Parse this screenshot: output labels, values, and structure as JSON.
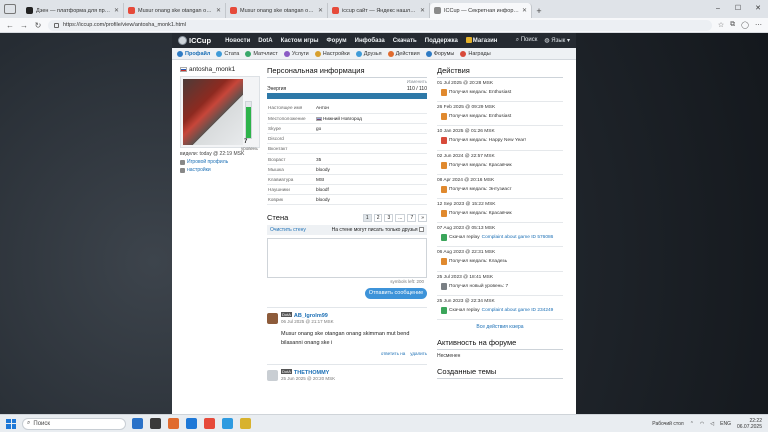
{
  "browser": {
    "tabs": [
      {
        "title": "Дзен — платформа для просмо",
        "color": "#222222",
        "active": false
      },
      {
        "title": "Musur onang ske otangan onang s",
        "color": "#e64a3a",
        "active": false
      },
      {
        "title": "Musur onang ske otangan onang",
        "color": "#e64a3a",
        "active": false
      },
      {
        "title": "iccup сайт — Яндекс нашлось 6",
        "color": "#e64a3a",
        "active": false
      },
      {
        "title": "ICCup — Секретная информаци",
        "color": "#8a8a8a",
        "active": true
      }
    ],
    "url": "https://iccup.com/profile/view/antosha_monk1.html",
    "window_controls": [
      "–",
      "☐",
      "✕"
    ]
  },
  "topnav": {
    "logo": "ICCup",
    "links": [
      "Новости",
      "DotA",
      "Кастом игры",
      "Форум",
      "Инфобаза",
      "Скачать",
      "Поддержка",
      "Магазин"
    ],
    "search": "Поиск",
    "language": "Язык"
  },
  "subnav": [
    {
      "label": "Профайл",
      "color": "#2e7bc4",
      "active": true
    },
    {
      "label": "Стата",
      "color": "#3f9bd8",
      "active": false
    },
    {
      "label": "Матчлист",
      "color": "#38a86a",
      "active": false
    },
    {
      "label": "Услуги",
      "color": "#8a5bc4",
      "active": false
    },
    {
      "label": "Настройки",
      "color": "#d8a02e",
      "active": false
    },
    {
      "label": "Друзья",
      "color": "#3f9bd8",
      "active": false
    },
    {
      "label": "Действия",
      "color": "#e06b2e",
      "active": false
    },
    {
      "label": "Форумы",
      "color": "#2e7bc4",
      "active": false
    },
    {
      "label": "Награды",
      "color": "#d84a3a",
      "active": false
    }
  ],
  "profile": {
    "username": "antosha_monk1",
    "level": "7",
    "level_caption": "уровень",
    "level_fill": 0.85,
    "last_seen": "видели: today @ 22:19 MSK",
    "links": [
      "Игровой профиль",
      "настройки"
    ]
  },
  "personal": {
    "title": "Персональная информация",
    "edit": "Изменить",
    "energy_label": "Энергия",
    "energy_value": "110 / 110",
    "energy_fill": 1.0,
    "rows": [
      {
        "k": "Настоящее имя",
        "v": "Антон"
      },
      {
        "k": "Местоположение",
        "v": "Нижний Новгород"
      },
      {
        "k": "Skype",
        "v": "go"
      },
      {
        "k": "Discord",
        "v": ""
      },
      {
        "k": "Вконтакт",
        "v": ""
      },
      {
        "k": "Возраст",
        "v": "35"
      },
      {
        "k": "Мышка",
        "v": "bloody"
      },
      {
        "k": "Клавиатура",
        "v": "MSI"
      },
      {
        "k": "Наушники",
        "v": "bloodf"
      },
      {
        "k": "Коврик",
        "v": "bloody"
      }
    ]
  },
  "wall": {
    "title": "Стена",
    "pages": [
      "1",
      "2",
      "3",
      "...",
      "7",
      "»"
    ],
    "clear_link": "Очистить стену",
    "friends_only": "На стене могут писать только друзья",
    "counter": "symbols left: 200",
    "send_button": "Отпавить сообщение",
    "posts": [
      {
        "tag": "DotA",
        "author": "AB_Igrolm99",
        "date": "06 Jul 2025 @ 21:17 MSK",
        "text": "Musur onang ske otangan onang skimman mut bend bilasanni onang ske i",
        "actions": [
          "ответить на",
          "удалить"
        ],
        "avatar_color": "#8d5b3a"
      },
      {
        "tag": "DotA",
        "author": "THETHOMMY",
        "date": "25 Jun 2025 @ 20:20 MSK",
        "text": "",
        "actions": [],
        "avatar_color": "#c9ced3"
      }
    ]
  },
  "activity": {
    "title": "Действия",
    "items": [
      {
        "date": "01 Jul 2025 @ 20:28 MSK",
        "text": "Получил медаль: Enthusiast",
        "link": "",
        "medal": "#e0892e"
      },
      {
        "date": "26 Feb 2025 @ 09:29 MSK",
        "text": "Получил медаль: Enthusiast",
        "link": "",
        "medal": "#e0892e"
      },
      {
        "date": "10 Jan 2025 @ 01:26 MSK",
        "text": "Получил медаль: Happy New Year!",
        "link": "",
        "medal": "#d84a3a"
      },
      {
        "date": "02 Jun 2024 @ 22:57 MSK",
        "text": "Получил медаль: Красавчик",
        "link": "",
        "medal": "#e0892e"
      },
      {
        "date": "08 Apr 2024 @ 20:16 MSK",
        "text": "Получил медаль: Энтузиаст",
        "link": "",
        "medal": "#e0892e"
      },
      {
        "date": "12 Sep 2023 @ 15:22 MSK",
        "text": "Получил медаль: Красавчик",
        "link": "",
        "medal": "#e0892e"
      },
      {
        "date": "07 Aug 2023 @ 05:13 MSK",
        "text": "Скачал replay",
        "link": "Complaint about game ID 576086",
        "medal": "#3aa55a"
      },
      {
        "date": "06 Aug 2023 @ 22:31 MSK",
        "text": "Получил медаль: Кладезь",
        "link": "",
        "medal": "#e0892e"
      },
      {
        "date": "25 Jul 2023 @ 18:41 MSK",
        "text": "Получил новый уровень: 7",
        "link": "",
        "medal": "#7a7f84"
      },
      {
        "date": "25 Jun 2023 @ 22:34 MSK",
        "text": "Скачал replay",
        "link": "Complaint about game ID 234249",
        "medal": "#3aa55a"
      }
    ],
    "all_link": "Все действия юзера"
  },
  "forum_activity": {
    "title": "Активность на форуме",
    "body": "Несменен"
  },
  "created_topics": {
    "title": "Созданные темы"
  },
  "taskbar": {
    "search": "Поиск",
    "tray_label": "Рабочий стол",
    "lang": "ENG",
    "time": "22:22",
    "date": "06.07.2025",
    "icons": [
      "#2a72c8",
      "#3a3a3a",
      "#e06b2e",
      "#1e78d7",
      "#e64a3a",
      "#2e9be0",
      "#d8b22e"
    ]
  }
}
